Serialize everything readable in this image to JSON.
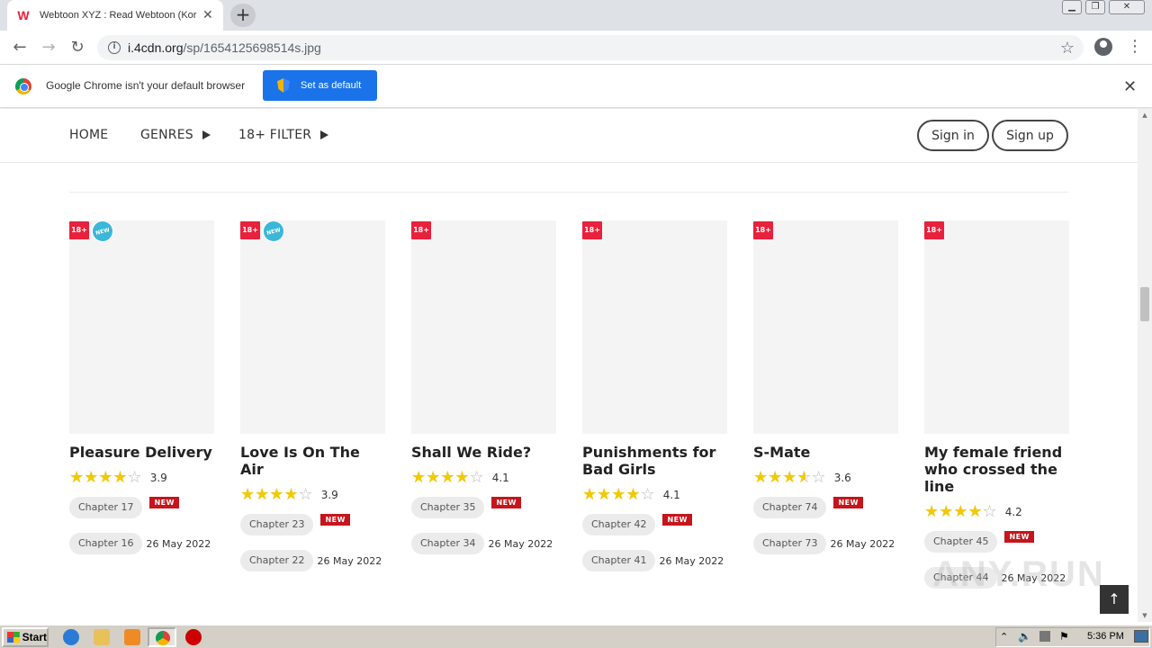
{
  "browser": {
    "tab_title": "Webtoon XYZ : Read Webtoon (Korean...",
    "tab_favicon": "W",
    "url_host": "i.4cdn.org",
    "url_path": "/sp/1654125698514s.jpg"
  },
  "infobar": {
    "message": "Google Chrome isn't your default browser",
    "button_label": "Set as default"
  },
  "site_nav": {
    "home": "HOME",
    "genres": "GENRES",
    "filter": "18+ FILTER",
    "sign_in": "Sign in",
    "sign_up": "Sign up"
  },
  "cards": [
    {
      "title": "Pleasure Delivery",
      "rating": "3.9",
      "rating_value": 3.9,
      "badge": "18+",
      "is_new_badge": "NEW",
      "chapters": [
        {
          "label": "Chapter 17",
          "new": "NEW",
          "date": ""
        },
        {
          "label": "Chapter 16",
          "new": "",
          "date": "26 May 2022"
        }
      ]
    },
    {
      "title": "Love Is On The Air",
      "rating": "3.9",
      "rating_value": 3.9,
      "badge": "18+",
      "is_new_badge": "NEW",
      "chapters": [
        {
          "label": "Chapter 23",
          "new": "NEW",
          "date": ""
        },
        {
          "label": "Chapter 22",
          "new": "",
          "date": "26 May 2022"
        }
      ]
    },
    {
      "title": "Shall We Ride?",
      "rating": "4.1",
      "rating_value": 4.1,
      "badge": "18+",
      "is_new_badge": "",
      "chapters": [
        {
          "label": "Chapter 35",
          "new": "NEW",
          "date": ""
        },
        {
          "label": "Chapter 34",
          "new": "",
          "date": "26 May 2022"
        }
      ]
    },
    {
      "title": "Punishments for Bad Girls",
      "rating": "4.1",
      "rating_value": 4.1,
      "badge": "18+",
      "is_new_badge": "",
      "chapters": [
        {
          "label": "Chapter 42",
          "new": "NEW",
          "date": ""
        },
        {
          "label": "Chapter 41",
          "new": "",
          "date": "26 May 2022"
        }
      ]
    },
    {
      "title": "S-Mate",
      "rating": "3.6",
      "rating_value": 3.6,
      "badge": "18+",
      "is_new_badge": "",
      "chapters": [
        {
          "label": "Chapter 74",
          "new": "NEW",
          "date": ""
        },
        {
          "label": "Chapter 73",
          "new": "",
          "date": "26 May 2022"
        }
      ]
    },
    {
      "title": "My female friend who crossed the line",
      "rating": "4.2",
      "rating_value": 4.2,
      "badge": "18+",
      "is_new_badge": "",
      "chapters": [
        {
          "label": "Chapter 45",
          "new": "NEW",
          "date": ""
        },
        {
          "label": "Chapter 44",
          "new": "",
          "date": "26 May 2022"
        }
      ]
    }
  ],
  "watermark": "ANY.RUN",
  "taskbar": {
    "start_label": "Start",
    "clock": "5:36 PM"
  },
  "colors": {
    "accent_blue": "#1a73e8",
    "badge_red": "#e8213c",
    "new_tag_red": "#c4161c",
    "star_yellow": "#f3c900",
    "new_round_badge": "#3ab7d9"
  }
}
